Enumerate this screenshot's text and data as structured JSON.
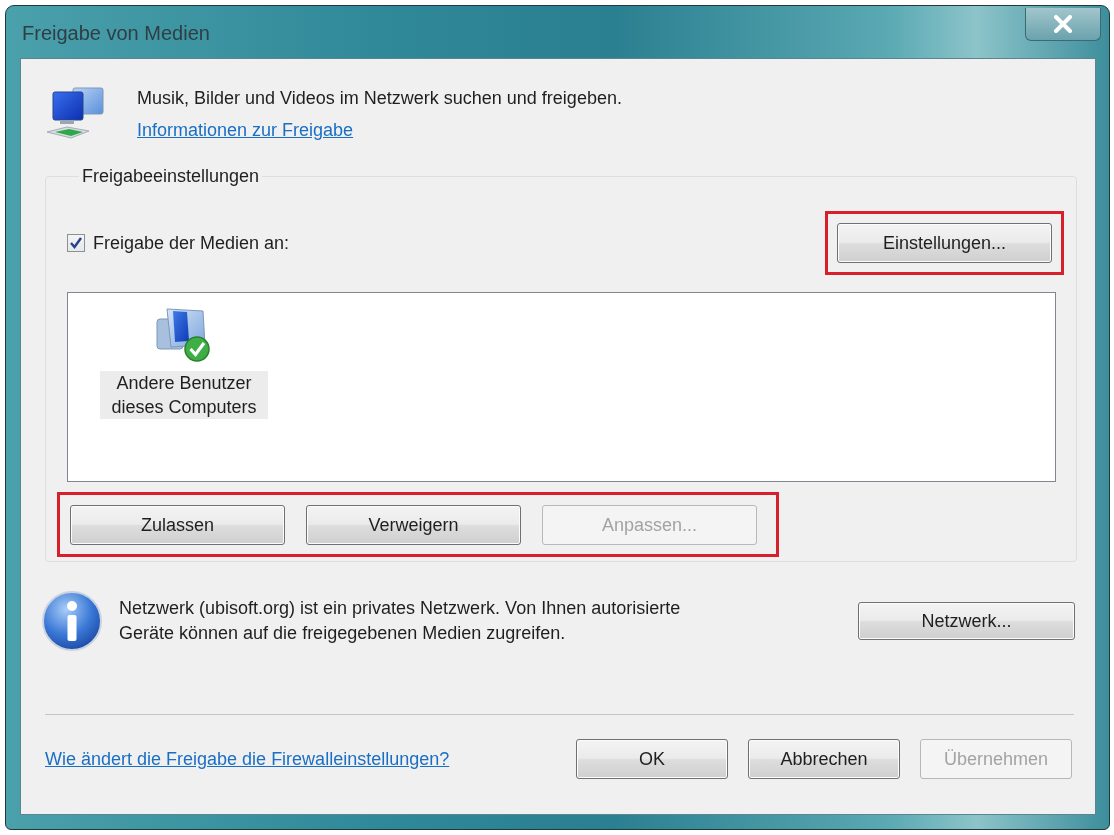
{
  "window": {
    "title": "Freigabe von Medien"
  },
  "header": {
    "text": "Musik, Bilder und Videos im Netzwerk suchen und freigeben.",
    "link": "Informationen zur Freigabe"
  },
  "sharing_settings": {
    "title": "Freigabeeinstellungen",
    "checkbox": {
      "label": "Freigabe der Medien an:",
      "checked": true
    },
    "settings_button": {
      "label": "Einstellungen...",
      "disabled": false,
      "highlighted": true
    },
    "devices": [
      {
        "label": "Andere Benutzer dieses Computers",
        "allowed": true,
        "selected": true
      }
    ],
    "device_buttons": {
      "highlighted": true,
      "buttons": [
        {
          "label": "Zulassen",
          "disabled": false
        },
        {
          "label": "Verweigern",
          "disabled": false
        },
        {
          "label": "Anpassen...",
          "disabled": true
        }
      ]
    }
  },
  "network": {
    "text": "Netzwerk (ubisoft.org) ist ein privates Netzwerk. Von Ihnen autorisierte Geräte können auf die freigegebenen Medien zugreifen.",
    "button": {
      "label": "Netzwerk...",
      "disabled": false
    }
  },
  "footer": {
    "link": "Wie ändert die Freigabe die Firewalleinstellungen?",
    "buttons": [
      {
        "label": "OK",
        "disabled": false
      },
      {
        "label": "Abbrechen",
        "disabled": false
      },
      {
        "label": "Übernehmen",
        "disabled": true
      }
    ]
  }
}
